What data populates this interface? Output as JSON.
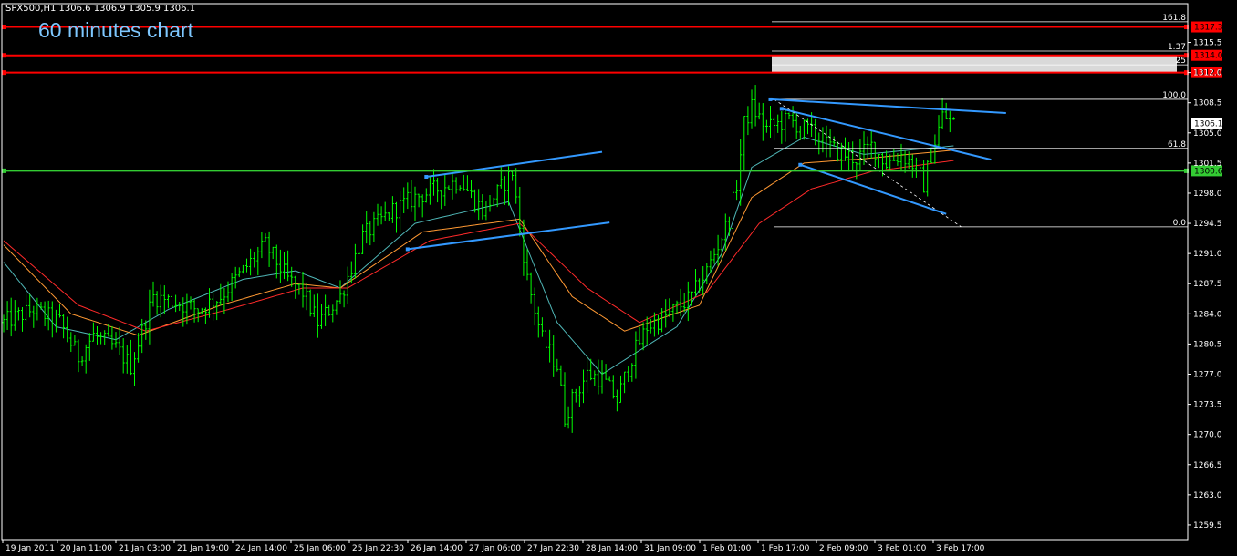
{
  "header": {
    "symbol_info": "SPX500,H1  1306.6 1306.9 1305.9 1306.1",
    "caption": "60 minutes chart"
  },
  "colors": {
    "background": "#000000",
    "candle": "#00ff00",
    "grid_axis": "#ffffff",
    "ma_fast": "#4fb6b6",
    "ma_mid": "#ff9933",
    "ma_slow": "#ff2a2a",
    "trendline": "#3399ff",
    "hline_red": "#ff0000",
    "hline_green": "#33cc33",
    "box_gray": "#d9d9d9"
  },
  "chart_data": {
    "type": "candlestick",
    "symbol": "SPX500",
    "timeframe": "H1",
    "ylim": [
      1257.8,
      1320.0
    ],
    "y_ticks": [
      "1315.5",
      "1312.0",
      "1308.5",
      "1305.0",
      "1301.5",
      "1298.0",
      "1294.5",
      "1291.0",
      "1287.5",
      "1284.0",
      "1280.5",
      "1277.0",
      "1273.5",
      "1270.0",
      "1266.5",
      "1263.0",
      "1259.5"
    ],
    "x_tick_labels": [
      "19 Jan 2011",
      "20 Jan 11:00",
      "21 Jan 03:00",
      "21 Jan 19:00",
      "24 Jan 14:00",
      "25 Jan 06:00",
      "25 Jan 22:30",
      "26 Jan 14:00",
      "27 Jan 06:00",
      "27 Jan 22:30",
      "28 Jan 14:00",
      "31 Jan 09:00",
      "1 Feb 01:00",
      "1 Feb 17:00",
      "2 Feb 09:00",
      "3 Feb 01:00",
      "3 Feb 17:00"
    ],
    "bar_count": 260,
    "close_path": [
      [
        0,
        1283.0
      ],
      [
        8,
        1284.5
      ],
      [
        15,
        1283.0
      ],
      [
        20,
        1279.0
      ],
      [
        24,
        1281.5
      ],
      [
        30,
        1280.0
      ],
      [
        34,
        1278.0
      ],
      [
        40,
        1286.0
      ],
      [
        45,
        1285.5
      ],
      [
        52,
        1284.5
      ],
      [
        58,
        1286.0
      ],
      [
        64,
        1289.0
      ],
      [
        70,
        1292.0
      ],
      [
        76,
        1288.0
      ],
      [
        80,
        1286.5
      ],
      [
        84,
        1283.0
      ],
      [
        90,
        1286.0
      ],
      [
        96,
        1293.0
      ],
      [
        104,
        1296.0
      ],
      [
        110,
        1297.5
      ],
      [
        116,
        1298.5
      ],
      [
        122,
        1299.5
      ],
      [
        128,
        1296.0
      ],
      [
        132,
        1298.0
      ],
      [
        136,
        1300.5
      ],
      [
        138,
        1294.0
      ],
      [
        140,
        1288.0
      ],
      [
        144,
        1281.0
      ],
      [
        148,
        1278.0
      ],
      [
        150,
        1272.0
      ],
      [
        152,
        1274.0
      ],
      [
        156,
        1277.0
      ],
      [
        160,
        1276.5
      ],
      [
        164,
        1274.0
      ],
      [
        168,
        1279.0
      ],
      [
        172,
        1282.5
      ],
      [
        178,
        1284.0
      ],
      [
        184,
        1286.0
      ],
      [
        188,
        1289.0
      ],
      [
        190,
        1291.0
      ],
      [
        194,
        1295.0
      ],
      [
        196,
        1299.0
      ],
      [
        198,
        1306.0
      ],
      [
        200,
        1308.0
      ],
      [
        204,
        1305.5
      ],
      [
        210,
        1306.5
      ],
      [
        216,
        1305.0
      ],
      [
        222,
        1303.0
      ],
      [
        228,
        1302.0
      ],
      [
        232,
        1303.5
      ],
      [
        236,
        1301.5
      ],
      [
        240,
        1302.5
      ],
      [
        244,
        1301.0
      ],
      [
        246,
        1299.0
      ],
      [
        248,
        1302.5
      ],
      [
        251,
        1307.0
      ],
      [
        254,
        1306.1
      ]
    ],
    "series": [
      {
        "name": "",
        "kind": "moving-average",
        "color": "#4fb6b6",
        "points": [
          [
            0,
            1290.0
          ],
          [
            14,
            1282.5
          ],
          [
            30,
            1281.0
          ],
          [
            44,
            1284.5
          ],
          [
            64,
            1288.0
          ],
          [
            78,
            1289.0
          ],
          [
            90,
            1287.0
          ],
          [
            110,
            1294.5
          ],
          [
            135,
            1297.0
          ],
          [
            148,
            1283.0
          ],
          [
            160,
            1277.0
          ],
          [
            180,
            1282.5
          ],
          [
            192,
            1291.0
          ],
          [
            200,
            1301.0
          ],
          [
            214,
            1304.5
          ],
          [
            230,
            1302.5
          ],
          [
            254,
            1303.5
          ]
        ]
      },
      {
        "name": "",
        "kind": "moving-average",
        "color": "#ff9933",
        "points": [
          [
            0,
            1292.0
          ],
          [
            18,
            1284.0
          ],
          [
            36,
            1281.5
          ],
          [
            58,
            1285.0
          ],
          [
            78,
            1287.5
          ],
          [
            90,
            1287.0
          ],
          [
            112,
            1293.5
          ],
          [
            138,
            1295.0
          ],
          [
            152,
            1286.0
          ],
          [
            166,
            1282.0
          ],
          [
            186,
            1285.0
          ],
          [
            200,
            1297.5
          ],
          [
            214,
            1301.5
          ],
          [
            230,
            1302.0
          ],
          [
            254,
            1303.0
          ]
        ]
      },
      {
        "name": "",
        "kind": "moving-average",
        "color": "#ff2a2a",
        "points": [
          [
            0,
            1292.5
          ],
          [
            20,
            1285.0
          ],
          [
            38,
            1282.0
          ],
          [
            60,
            1284.5
          ],
          [
            80,
            1287.0
          ],
          [
            92,
            1287.0
          ],
          [
            114,
            1292.5
          ],
          [
            138,
            1294.5
          ],
          [
            156,
            1287.0
          ],
          [
            170,
            1283.0
          ],
          [
            188,
            1286.5
          ],
          [
            202,
            1294.5
          ],
          [
            216,
            1298.5
          ],
          [
            232,
            1300.5
          ],
          [
            254,
            1301.8
          ]
        ]
      }
    ],
    "horizontal_lines": [
      {
        "price": 1317.3,
        "label": "1317.3",
        "color": "#ff0000"
      },
      {
        "price": 1314.0,
        "label": "1314.0",
        "color": "#ff0000"
      },
      {
        "price": 1312.0,
        "label": "1312.0",
        "color": "#ff0000"
      },
      {
        "price": 1300.6,
        "label": "1300.6",
        "color": "#33cc33"
      }
    ],
    "fibonacci": {
      "from": {
        "bar": 206,
        "price": 1308.9
      },
      "to": {
        "bar": 256,
        "price": 1294.1
      },
      "levels": [
        {
          "label": "161.8",
          "price": 1317.9
        },
        {
          "label": "1.37",
          "price": 1314.5
        },
        {
          "label": "25",
          "price": 1312.9
        },
        {
          "label": "100.0",
          "price": 1308.9
        },
        {
          "label": "61.8",
          "price": 1303.2
        },
        {
          "label": "0.0",
          "price": 1294.1
        }
      ]
    },
    "trendlines": [
      {
        "from": [
          113,
          1299.9
        ],
        "to": [
          160,
          1302.8
        ]
      },
      {
        "from": [
          108,
          1291.5
        ],
        "to": [
          162,
          1294.6
        ]
      },
      {
        "from": [
          205,
          1308.9
        ],
        "to": [
          268,
          1307.3
        ]
      },
      {
        "from": [
          208,
          1307.8
        ],
        "to": [
          264,
          1301.9
        ]
      },
      {
        "from": [
          213,
          1301.3
        ],
        "to": [
          252,
          1295.6
        ]
      }
    ],
    "shaded_zone": {
      "price_top": 1314.0,
      "price_bottom": 1312.0
    },
    "price_markers": [
      {
        "label": "1306.1",
        "price": 1306.1
      }
    ]
  }
}
